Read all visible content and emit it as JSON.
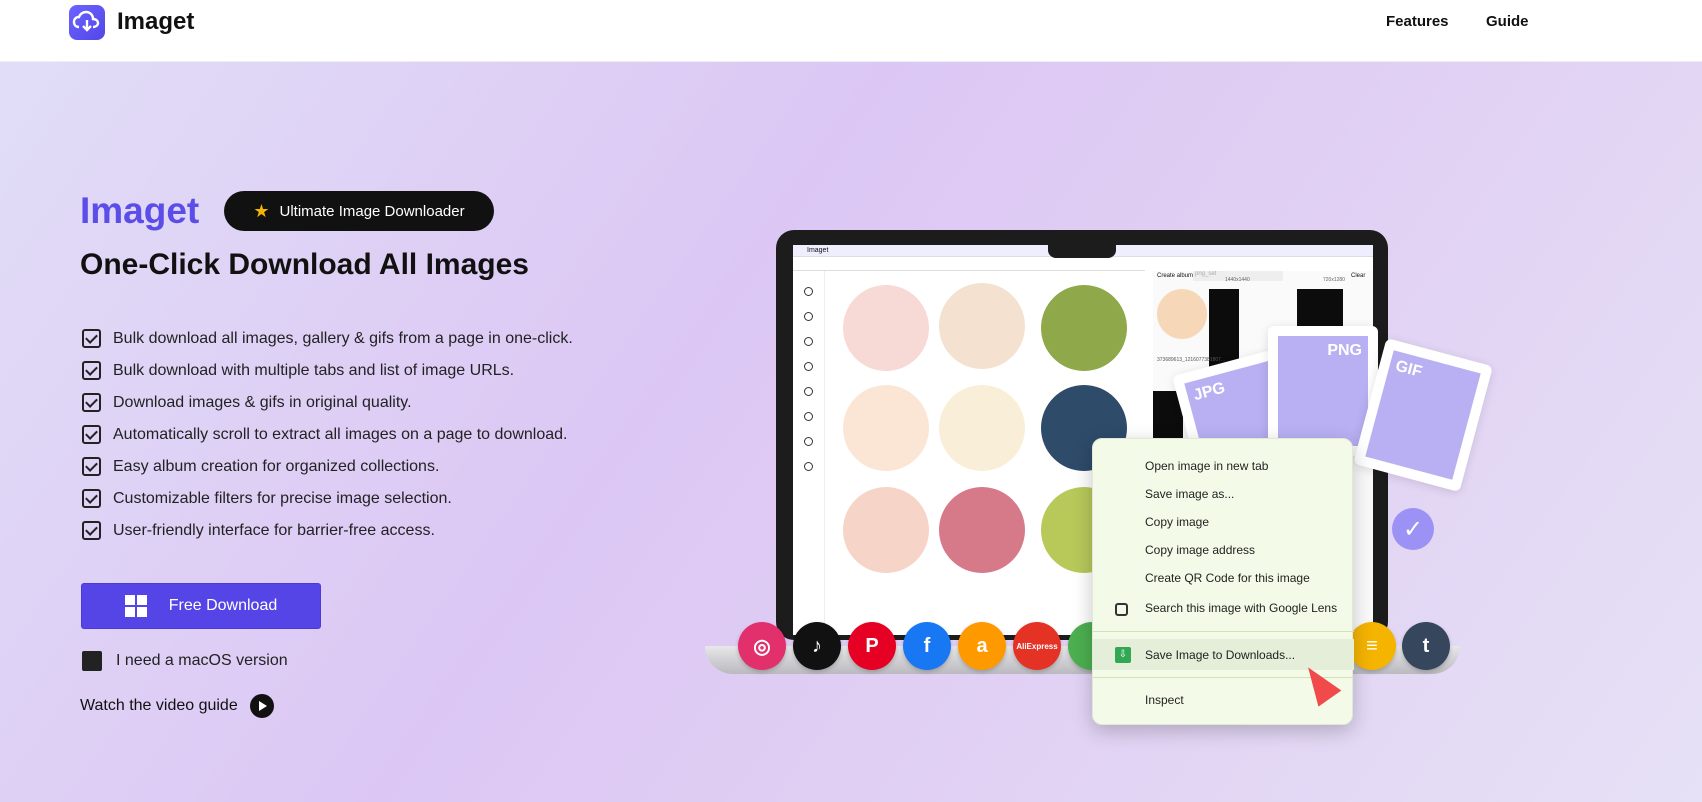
{
  "nav": {
    "brand": "Imaget",
    "links": [
      "Features",
      "Guide"
    ]
  },
  "hero": {
    "brand": "Imaget",
    "badge": "Ultimate Image Downloader",
    "title": "One-Click Download All Images",
    "features": [
      "Bulk download all images, gallery & gifs from a page in one-click.",
      "Bulk download with multiple tabs and list of image URLs.",
      "Download images & gifs in original quality.",
      "Automatically scroll to extract all images on a page to download.",
      "Easy album creation for organized collections.",
      "Customizable filters for precise image selection.",
      "User-friendly interface for barrier-free access."
    ],
    "download_label": "Free Download",
    "mac_label": "I need a macOS version",
    "video_label": "Watch the video guide"
  },
  "app_preview": {
    "window_title": "Imaget",
    "create_album": "Create album:",
    "album_placeholder": "png_set",
    "clear": "Clear",
    "size_labels": [
      "1440x1440",
      "720x1280"
    ],
    "file_label": "373689613_1216077381807...",
    "badge_jpg": "JPG",
    "badge_png": "PNG",
    "badge_gif": "GIF"
  },
  "context_menu": {
    "items": [
      "Open image in new tab",
      "Save image as...",
      "Copy image",
      "Copy image address",
      "Create QR Code for this image",
      "Search this image with Google Lens",
      "Save Image to Downloads...",
      "Inspect"
    ]
  },
  "social": [
    {
      "name": "instagram-icon",
      "glyph": "◎",
      "color": "#e1306c"
    },
    {
      "name": "tiktok-icon",
      "glyph": "♪",
      "color": "#111111"
    },
    {
      "name": "pinterest-icon",
      "glyph": "P",
      "color": "#e60023"
    },
    {
      "name": "facebook-icon",
      "glyph": "f",
      "color": "#1877f2"
    },
    {
      "name": "amazon-icon",
      "glyph": "a",
      "color": "#ff9900"
    },
    {
      "name": "aliexpress-icon",
      "glyph": "AliExpress",
      "color": "#e43225"
    },
    {
      "name": "chrome-icon",
      "glyph": "",
      "color": "#4caf50"
    },
    {
      "name": "bumble-icon",
      "glyph": "≡",
      "color": "#f5b400"
    },
    {
      "name": "tumblr-icon",
      "glyph": "t",
      "color": "#36465d"
    }
  ],
  "colors": {
    "accent": "#5645e6",
    "brand": "#5b4de8"
  }
}
